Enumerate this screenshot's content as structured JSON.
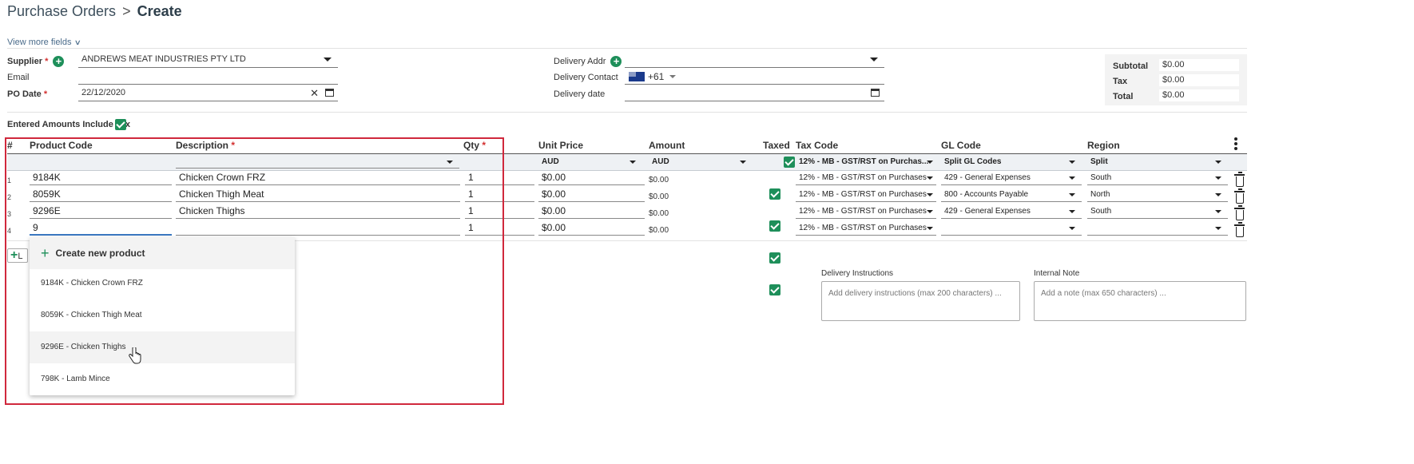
{
  "breadcrumb": {
    "parent": "Purchase Orders",
    "separator": ">",
    "current": "Create"
  },
  "view_more": "View more fields",
  "header": {
    "supplier_label": "Supplier",
    "supplier_value": "ANDREWS MEAT INDUSTRIES PTY LTD",
    "email_label": "Email",
    "email_value": "",
    "po_date_label": "PO Date",
    "po_date_value": "22/12/2020",
    "required_mark": "*",
    "delivery_addr_label": "Delivery Addr",
    "delivery_addr_value": "",
    "delivery_contact_label": "Delivery Contact",
    "phone_code": "+61",
    "delivery_date_label": "Delivery date",
    "delivery_date_value": ""
  },
  "totals": {
    "subtotal_label": "Subtotal",
    "subtotal_value": "$0.00",
    "tax_label": "Tax",
    "tax_value": "$0.00",
    "total_label": "Total",
    "total_value": "$0.00"
  },
  "entered_amounts_label": "Entered Amounts Include Tax",
  "entered_amounts_checked": true,
  "table": {
    "columns": {
      "num": "#",
      "product_code": "Product Code",
      "description": "Description",
      "qty": "Qty",
      "unit_price": "Unit Price",
      "amount": "Amount",
      "taxed": "Taxed",
      "tax_code": "Tax Code",
      "gl_code": "GL Code",
      "region": "Region"
    },
    "defaults": {
      "unit_price_currency": "AUD",
      "amount_currency": "AUD",
      "tax_code": "12% - MB - GST/RST on Purchas...",
      "gl_code": "Split GL Codes",
      "region": "Split"
    },
    "rows": [
      {
        "num": "1",
        "code": "9184K",
        "desc": "Chicken Crown FRZ",
        "qty": "1",
        "unit_price": "$0.00",
        "amount": "$0.00",
        "tax_code": "12% - MB - GST/RST on Purchases",
        "gl_code": "429 - General Expenses",
        "region": "South"
      },
      {
        "num": "2",
        "code": "8059K",
        "desc": "Chicken Thigh Meat",
        "qty": "1",
        "unit_price": "$0.00",
        "amount": "$0.00",
        "tax_code": "12% - MB - GST/RST on Purchases",
        "gl_code": "800 - Accounts Payable",
        "region": "North"
      },
      {
        "num": "3",
        "code": "9296E",
        "desc": "Chicken Thighs",
        "qty": "1",
        "unit_price": "$0.00",
        "amount": "$0.00",
        "tax_code": "12% - MB - GST/RST on Purchases",
        "gl_code": "429 - General Expenses",
        "region": "South"
      },
      {
        "num": "4",
        "code": "9",
        "desc": "",
        "qty": "1",
        "unit_price": "$0.00",
        "amount": "$0.00",
        "tax_code": "12% - MB - GST/RST on Purchases",
        "gl_code": "",
        "region": ""
      }
    ]
  },
  "add_line_label": "L",
  "dropdown": {
    "create_label": "Create new product",
    "options": [
      "9184K - Chicken Crown FRZ",
      "8059K - Chicken Thigh Meat",
      "9296E - Chicken Thighs",
      "798K - Lamb Mince"
    ],
    "hovered_index": 2
  },
  "delivery_instructions": {
    "label": "Delivery Instructions",
    "placeholder": "Add delivery instructions (max 200 characters) ..."
  },
  "internal_note": {
    "label": "Internal Note",
    "placeholder": "Add a note (max 650 characters) ..."
  },
  "colors": {
    "accent_green": "#1e8f5a",
    "highlight_red": "#d0283c",
    "required_red": "#d32f2f"
  }
}
